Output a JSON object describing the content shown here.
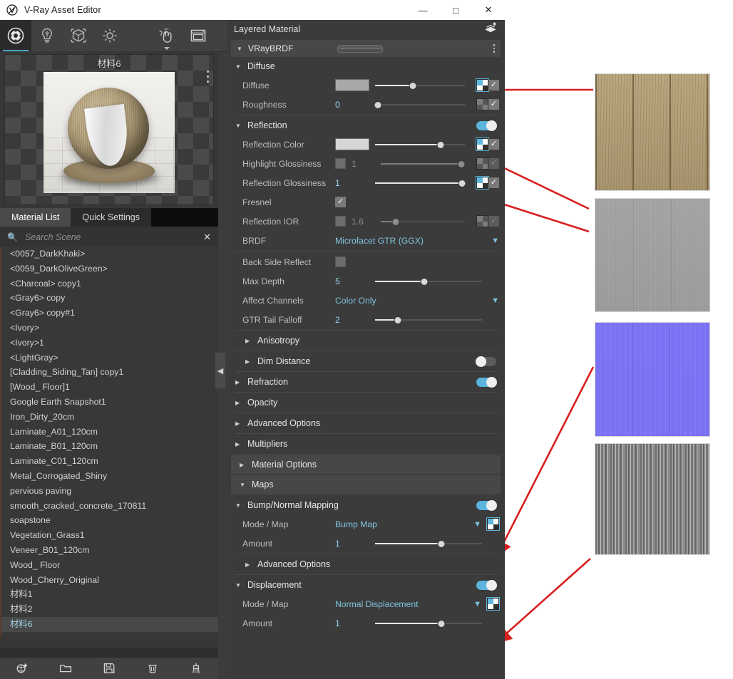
{
  "window": {
    "title": "V-Ray Asset Editor",
    "app_icon": "vray-logo-icon",
    "minimize": "—",
    "maximize": "□",
    "close": "✕"
  },
  "toolbar": {
    "items": [
      {
        "name": "materials-tab-icon",
        "label": "Materials",
        "active": true
      },
      {
        "name": "lights-tab-icon",
        "label": "Lights",
        "active": false
      },
      {
        "name": "geometry-tab-icon",
        "label": "Geometry",
        "active": false
      },
      {
        "name": "settings-tab-icon",
        "label": "Settings",
        "active": false
      }
    ],
    "right_items": [
      {
        "name": "interactive-render-icon",
        "label": "Render with V-Ray",
        "has_caret": true
      },
      {
        "name": "frame-buffer-icon",
        "label": "Show V-Ray Frame Buffer",
        "has_caret": false
      }
    ]
  },
  "preview": {
    "material_name": "材料6",
    "options_icon": "more-options-icon"
  },
  "tabs": [
    {
      "label": "Material List",
      "active": true
    },
    {
      "label": "Quick Settings",
      "active": false
    }
  ],
  "search": {
    "icon": "search-icon",
    "placeholder": "Search Scene",
    "value": "",
    "clear_icon": "clear-icon"
  },
  "material_list": [
    {
      "label": "<0057_DarkKhaki>",
      "selected": false
    },
    {
      "label": "<0059_DarkOliveGreen>",
      "selected": false
    },
    {
      "label": "<Charcoal> copy1",
      "selected": false
    },
    {
      "label": "<Gray6> copy",
      "selected": false
    },
    {
      "label": "<Gray6> copy#1",
      "selected": false
    },
    {
      "label": "<Ivory>",
      "selected": false
    },
    {
      "label": "<Ivory>1",
      "selected": false
    },
    {
      "label": "<LightGray>",
      "selected": false
    },
    {
      "label": "[Cladding_Siding_Tan] copy1",
      "selected": false
    },
    {
      "label": "[Wood_ Floor]1",
      "selected": false
    },
    {
      "label": "Google Earth Snapshot1",
      "selected": false
    },
    {
      "label": "Iron_Dirty_20cm",
      "selected": false
    },
    {
      "label": "Laminate_A01_120cm",
      "selected": false
    },
    {
      "label": "Laminate_B01_120cm",
      "selected": false
    },
    {
      "label": "Laminate_C01_120cm",
      "selected": false
    },
    {
      "label": "Metal_Corrogated_Shiny",
      "selected": false
    },
    {
      "label": "pervious paving",
      "selected": false
    },
    {
      "label": "smooth_cracked_concrete_170811",
      "selected": false
    },
    {
      "label": "soapstone",
      "selected": false
    },
    {
      "label": "Vegetation_Grass1",
      "selected": false
    },
    {
      "label": "Veneer_B01_120cm",
      "selected": false
    },
    {
      "label": "Wood_ Floor",
      "selected": false
    },
    {
      "label": "Wood_Cherry_Original",
      "selected": false
    },
    {
      "label": "材料1",
      "selected": false
    },
    {
      "label": "材料2",
      "selected": false
    },
    {
      "label": "材料6",
      "selected": true
    }
  ],
  "bottom_toolbar": [
    {
      "name": "add-material-icon",
      "label": "Add Material"
    },
    {
      "name": "open-folder-icon",
      "label": "Import Material"
    },
    {
      "name": "save-icon",
      "label": "Save Material"
    },
    {
      "name": "delete-icon",
      "label": "Delete Material"
    },
    {
      "name": "purge-icon",
      "label": "Purge Unused Materials"
    }
  ],
  "collapse_handle": {
    "icon": "chevron-left-icon"
  },
  "properties": {
    "header": {
      "title": "Layered Material",
      "add_layer_icon": "add-layer-icon"
    },
    "brdf_row": {
      "name": "VRayBRDF",
      "expanded": true,
      "menu_icon": "kebab-menu-icon"
    },
    "diffuse_section": {
      "title": "Diffuse",
      "expanded": true,
      "rows": [
        {
          "label": "Diffuse",
          "value": "",
          "swatch": "#b0b0b0",
          "slider_pct": 42,
          "tex_active": true,
          "checked": true
        },
        {
          "label": "Roughness",
          "value": "0",
          "slider_pct": 3,
          "tex_active": false,
          "checked": true
        }
      ]
    },
    "reflection_section": {
      "title": "Reflection",
      "expanded": true,
      "enabled": true,
      "rows": [
        {
          "label": "Reflection Color",
          "value": "",
          "swatch": "#d6d6d6",
          "slider_pct": 73,
          "tex_active": true,
          "checked": true
        },
        {
          "label": "Highlight Glossiness",
          "value": "1",
          "slider_pct": 96,
          "tex_active": false,
          "checked": true,
          "dimmed": true
        },
        {
          "label": "Reflection Glossiness",
          "value": "1",
          "slider_pct": 97,
          "tex_active": true,
          "checked": true
        },
        {
          "label": "Fresnel",
          "value": "",
          "checked": true
        },
        {
          "label": "Reflection IOR",
          "value": "1.6",
          "slider_pct": 18,
          "tex_active": false,
          "checked": true,
          "dimmed": true
        },
        {
          "label": "BRDF",
          "value": "Microfacet GTR (GGX)",
          "dropdown": true
        }
      ]
    },
    "extra_rows": [
      {
        "label": "Back Side Reflect",
        "value": "",
        "checkbox_off": true
      },
      {
        "label": "Max Depth",
        "value": "5",
        "slider_pct": 46
      },
      {
        "label": "Affect Channels",
        "value": "Color Only",
        "dropdown": true
      },
      {
        "label": "GTR Tail Falloff",
        "value": "2",
        "slider_pct": 21
      }
    ],
    "collapsed_sections": [
      {
        "title": "Anisotropy",
        "indent": true,
        "toggle": null
      },
      {
        "title": "Dim Distance",
        "indent": true,
        "toggle": "off"
      },
      {
        "title": "Refraction",
        "indent": false,
        "toggle": "on"
      },
      {
        "title": "Opacity",
        "indent": false,
        "toggle": null
      },
      {
        "title": "Advanced Options",
        "indent": false,
        "toggle": null
      },
      {
        "title": "Multipliers",
        "indent": false,
        "toggle": null
      },
      {
        "title": "Material Options",
        "indent": false,
        "toggle": null,
        "highlight": true
      }
    ],
    "maps_section": {
      "title": "Maps",
      "expanded": true,
      "highlight": true,
      "bump": {
        "title": "Bump/Normal Mapping",
        "enabled": true,
        "mode_label": "Mode / Map",
        "mode_value": "Bump Map",
        "amount_label": "Amount",
        "amount_value": "1",
        "amount_pct": 62,
        "advanced_label": "Advanced Options"
      },
      "displacement": {
        "title": "Displacement",
        "enabled": true,
        "mode_label": "Mode / Map",
        "mode_value": "Normal Displacement",
        "amount_label": "Amount",
        "amount_value": "1",
        "amount_pct": 62
      }
    }
  },
  "texture_previews": [
    {
      "name": "diffuse-texture-thumbnail",
      "description": "Tan vertical wood plank siding diffuse map"
    },
    {
      "name": "reflection-texture-thumbnail",
      "description": "Flat gray reflection/glossiness map"
    },
    {
      "name": "normal-texture-thumbnail",
      "description": "Periwinkle blue tangent-space normal map"
    },
    {
      "name": "displacement-texture-thumbnail",
      "description": "Grayscale vertical stripe displacement map"
    }
  ],
  "annotation_arrows": {
    "color": "#d81f1f",
    "count": 4
  }
}
